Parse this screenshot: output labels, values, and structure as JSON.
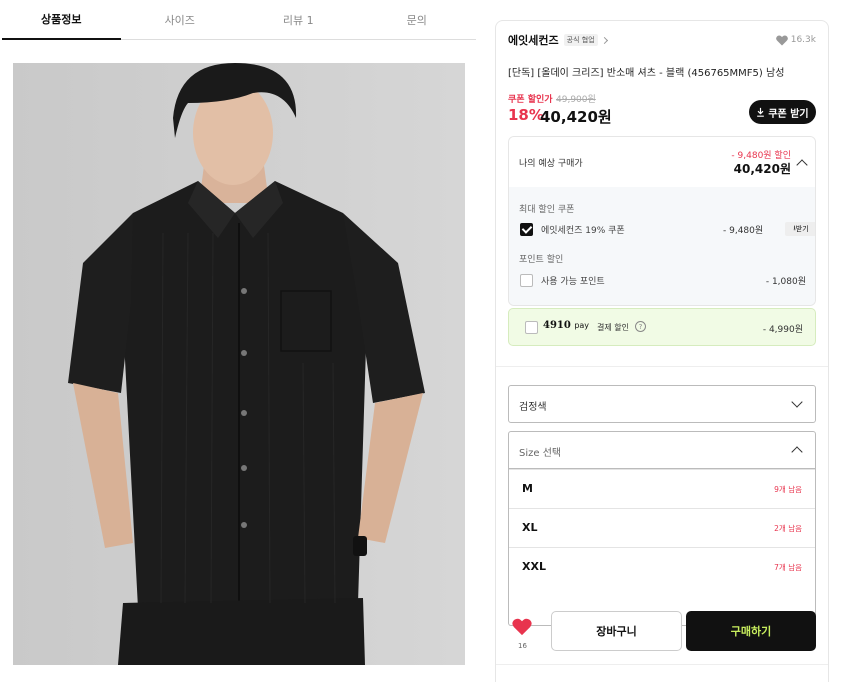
{
  "tabs": [
    "상품정보",
    "사이즈",
    "리뷰 1",
    "문의"
  ],
  "brand": {
    "name": "에잇세컨즈",
    "badge": "공식 협업",
    "likes": "16.3k"
  },
  "product": {
    "title": "[단독] [올데이 크리즈] 반소매 셔츠 - 블랙 (456765MMF5) 남성",
    "coupon_label": "쿠폰 할인가",
    "original_price": "49,900원",
    "discount_rate": "18%",
    "final_price": "40,420원",
    "coupon_button": "쿠폰 받기"
  },
  "estimate": {
    "label": "나의 예상 구매가",
    "discount": "- 9,480원 할인",
    "price": "40,420원",
    "max_coupon_title": "최대 할인 쿠폰",
    "coupon_name": "에잇세컨즈 19% 쿠폰",
    "coupon_amount": "- 9,480원",
    "coupon_get": "받기",
    "coupon_checked": true,
    "point_title": "포인트 할인",
    "point_name": "사용 가능 포인트",
    "point_amount": "- 1,080원",
    "point_checked": false
  },
  "pay": {
    "logo": "4910",
    "logo_suffix": "pay",
    "text": "결제 할인",
    "help": "?",
    "amount": "- 4,990원"
  },
  "color_select": {
    "value": "검정색"
  },
  "size_select": {
    "placeholder": "Size 선택",
    "options": [
      {
        "name": "M",
        "stock": "9개 남음"
      },
      {
        "name": "XL",
        "stock": "2개 남음"
      },
      {
        "name": "XXL",
        "stock": "7개 남음"
      }
    ]
  },
  "actions": {
    "like_count": "16",
    "cart": "장바구니",
    "buy": "구매하기"
  },
  "colors": {
    "accent_red": "#e8344e",
    "buy_text": "#c8ee5e",
    "pay_bg": "#f1fbe5"
  }
}
